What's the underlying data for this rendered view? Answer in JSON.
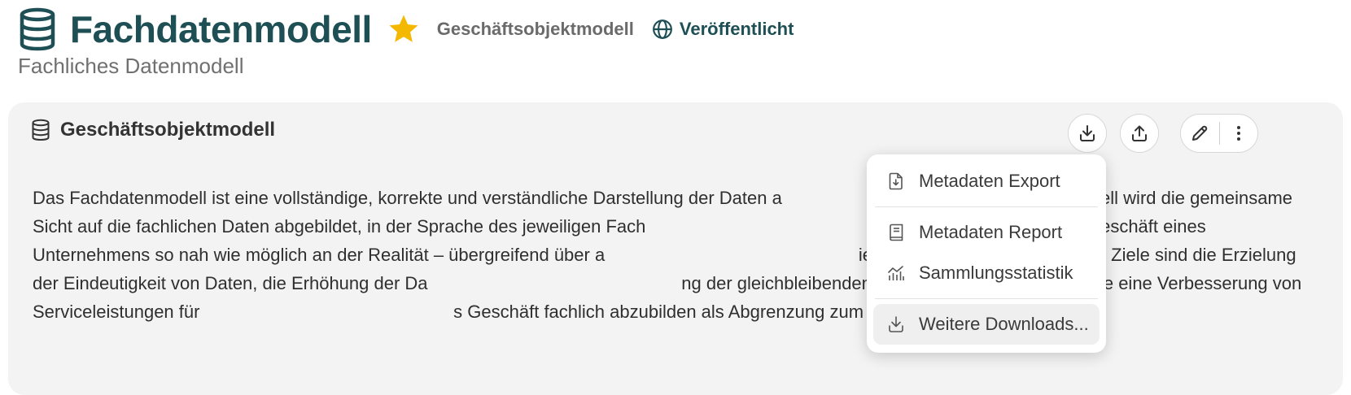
{
  "header": {
    "title": "Fachdatenmodell",
    "type_label": "Geschäftsobjektmodell",
    "status": "Veröffentlicht",
    "subtitle": "Fachliches Datenmodell",
    "favorite": true
  },
  "card": {
    "title": "Geschäftsobjektmodell",
    "description": "Das Fachdatenmodell ist eine vollständige, korrekte und verständliche Darstellung der Daten a                                                   em Modell wird die gemeinsame Sicht auf die fachlichen Daten abgebildet, in der Sprache des jeweiligen Fach                                                  n lesbar. Ziel ist es, das Geschäft eines Unternehmens so nah wie möglich an der Realität – übergreifend über a                                                   ierungen – abzubilden. Weitere Ziele sind die Erzielung der Eindeutigkeit von Daten, die Erhöhung der Da                                                   ng der gleichbleibenden Verwendung von Daten sowie eine Verbesserung von Serviceleistungen für                                                   s Geschäft fachlich abzubilden als Abgrenzung zum technischen Modell."
  },
  "toolbar": {
    "icons": [
      "download-icon",
      "upload-icon",
      "pencil-icon",
      "more-vertical-icon"
    ]
  },
  "menu": {
    "items": [
      {
        "label": "Metadaten Export",
        "icon": "file-download-icon"
      },
      {
        "label": "Metadaten Report",
        "icon": "book-icon"
      },
      {
        "label": "Sammlungsstatistik",
        "icon": "chart-icon"
      },
      {
        "label": "Weitere Downloads...",
        "icon": "download-icon"
      }
    ]
  },
  "colors": {
    "brand": "#1d4f55",
    "star": "#f5b800",
    "card_bg": "#f3f3f3"
  }
}
